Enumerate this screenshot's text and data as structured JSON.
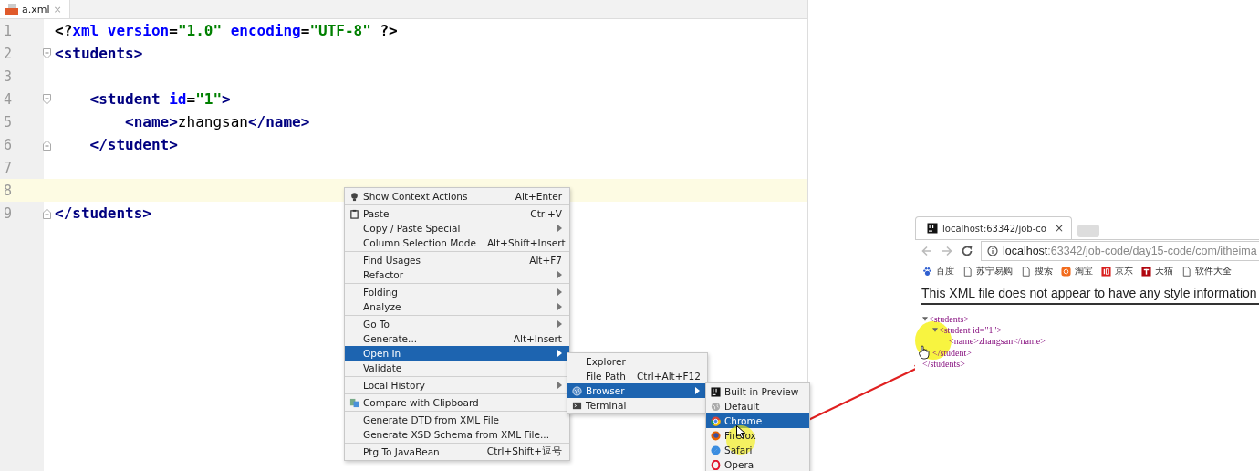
{
  "editor": {
    "tab": {
      "label": "a.xml",
      "close": "×"
    },
    "lines": [
      {
        "number": "1",
        "current": false,
        "kind": "plain",
        "tokens": [
          {
            "kind": "punct",
            "text": "<?"
          },
          {
            "kind": "attr",
            "text": "xml version"
          },
          {
            "kind": "punct",
            "text": "="
          },
          {
            "kind": "value",
            "text": "\"1.0\""
          },
          {
            "kind": "attr",
            "text": " encoding"
          },
          {
            "kind": "punct",
            "text": "="
          },
          {
            "kind": "value",
            "text": "\"UTF-8\""
          },
          {
            "kind": "punct",
            "text": " ?>"
          }
        ]
      },
      {
        "number": "2",
        "current": false,
        "kind": "fold-start",
        "tokens": [
          {
            "kind": "tag",
            "text": "<students>"
          }
        ]
      },
      {
        "number": "3",
        "current": false,
        "kind": "plain"
      },
      {
        "number": "4",
        "current": false,
        "kind": "fold-start",
        "tokens": [
          {
            "kind": "tag",
            "text": "    <student "
          },
          {
            "kind": "attr",
            "text": "id"
          },
          {
            "kind": "punct",
            "text": "="
          },
          {
            "kind": "value",
            "text": "\"1\""
          },
          {
            "kind": "tag",
            "text": ">"
          }
        ]
      },
      {
        "number": "5",
        "current": false,
        "kind": "plain",
        "tokens": [
          {
            "kind": "tag",
            "text": "        <name>"
          },
          {
            "kind": "text",
            "text": "zhangsan"
          },
          {
            "kind": "tag",
            "text": "</name>"
          }
        ]
      },
      {
        "number": "6",
        "current": false,
        "kind": "fold-end",
        "tokens": [
          {
            "kind": "tag",
            "text": "    </student>"
          }
        ]
      },
      {
        "number": "7",
        "current": false,
        "kind": "plain"
      },
      {
        "number": "8",
        "current": true,
        "kind": "plain"
      },
      {
        "number": "9",
        "current": false,
        "kind": "fold-end",
        "tokens": [
          {
            "kind": "tag",
            "text": "</students>"
          }
        ]
      }
    ]
  },
  "context_menu": {
    "groups": [
      [
        {
          "label": "Show Context Actions",
          "shortcut": "Alt+Enter",
          "submenu": false,
          "selected": false
        }
      ],
      [
        {
          "label": "Paste",
          "shortcut": "Ctrl+V",
          "submenu": false,
          "selected": false
        },
        {
          "label": "Copy / Paste Special",
          "submenu": true,
          "selected": false
        },
        {
          "label": "Column Selection Mode",
          "shortcut": "Alt+Shift+Insert",
          "submenu": false,
          "selected": false
        }
      ],
      [
        {
          "label": "Find Usages",
          "shortcut": "Alt+F7",
          "submenu": false,
          "selected": false
        },
        {
          "label": "Refactor",
          "submenu": true,
          "selected": false
        }
      ],
      [
        {
          "label": "Folding",
          "submenu": true,
          "selected": false
        },
        {
          "label": "Analyze",
          "submenu": true,
          "selected": false
        }
      ],
      [
        {
          "label": "Go To",
          "submenu": true,
          "selected": false
        },
        {
          "label": "Generate...",
          "shortcut": "Alt+Insert",
          "submenu": false,
          "selected": false
        },
        {
          "label": "Open In",
          "submenu": true,
          "selected": true
        },
        {
          "label": "Validate",
          "submenu": false,
          "selected": false
        }
      ],
      [
        {
          "label": "Local History",
          "submenu": true,
          "selected": false
        }
      ],
      [
        {
          "label": "Compare with Clipboard",
          "submenu": false,
          "selected": false
        }
      ],
      [
        {
          "label": "Generate DTD from XML File",
          "submenu": false,
          "selected": false
        },
        {
          "label": "Generate XSD Schema from XML File...",
          "submenu": false,
          "selected": false
        }
      ],
      [
        {
          "label": "Ptg To JavaBean",
          "shortcut": "Ctrl+Shift+逗号",
          "submenu": false,
          "selected": false
        }
      ]
    ]
  },
  "open_in_menu": {
    "items": [
      {
        "label": "Explorer",
        "submenu": false,
        "selected": false
      },
      {
        "label": "File Path",
        "shortcut": "Ctrl+Alt+F12",
        "submenu": false,
        "selected": false
      },
      {
        "label": "Browser",
        "submenu": true,
        "selected": true
      },
      {
        "label": "Terminal",
        "submenu": false,
        "selected": false
      }
    ]
  },
  "browser_menu": {
    "items": [
      {
        "label": "Built-in Preview",
        "selected": false
      },
      {
        "label": "Default",
        "selected": false
      },
      {
        "label": "Chrome",
        "selected": true
      },
      {
        "label": "Firefox",
        "selected": false
      },
      {
        "label": "Safari",
        "selected": false
      },
      {
        "label": "Opera",
        "selected": false
      }
    ]
  },
  "browser": {
    "tab": {
      "title": "localhost:63342/job-co",
      "close": "×"
    },
    "address": {
      "host": "localhost",
      "rest": ":63342/job-code/day15-code/com/itheima"
    },
    "bookmarks": [
      {
        "label": "百度"
      },
      {
        "label": "苏宁易购"
      },
      {
        "label": "搜索"
      },
      {
        "label": "淘宝"
      },
      {
        "label": "京东"
      },
      {
        "label": "天猫"
      },
      {
        "label": "软件大全"
      }
    ],
    "message": "This XML file does not appear to have any style information",
    "tree": [
      {
        "text": "<students>",
        "toggle": true,
        "children": [
          {
            "text": "<student id=\"1\">",
            "toggle": true,
            "children": [
              {
                "text": "<name>zhangsan</name>",
                "toggle": false
              }
            ],
            "end": "</student>"
          }
        ],
        "end": "</students>"
      }
    ]
  }
}
